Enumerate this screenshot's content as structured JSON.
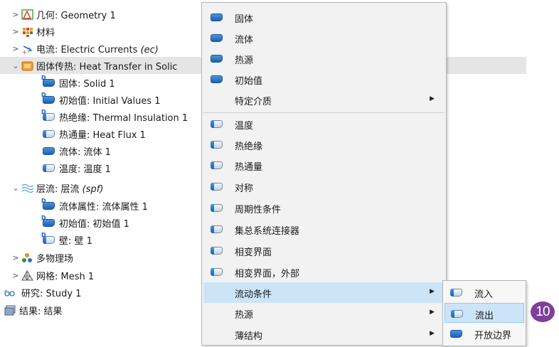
{
  "tree": {
    "items": [
      {
        "label": "几何: Geometry 1",
        "caret": ">",
        "icon": "geometry-icon"
      },
      {
        "label": "材料",
        "caret": ">",
        "icon": "materials-icon"
      },
      {
        "label_main": "电流: Electric Currents ",
        "label_tag": "(ec)",
        "caret": ">",
        "icon": "electric-currents-icon"
      },
      {
        "label": "固体传热: Heat Transfer in Solic",
        "caret": "⌄",
        "icon": "heat-transfer-icon"
      },
      {
        "label": "固体: Solid 1",
        "icon": "feature-icon"
      },
      {
        "label": "初始值: Initial Values 1",
        "icon": "feature-icon"
      },
      {
        "label": "热绝缘: Thermal Insulation 1",
        "icon": "boundary-feature-icon"
      },
      {
        "label": "热通量: Heat Flux 1",
        "icon": "boundary-feature-icon"
      },
      {
        "label": "流体: 流体 1",
        "icon": "feature-icon"
      },
      {
        "label": "温度: 温度 1",
        "icon": "boundary-feature-icon"
      },
      {
        "label_main": "层流: 层流 ",
        "label_tag": "(spf)",
        "caret": "⌄",
        "icon": "laminar-flow-icon"
      },
      {
        "label": "流体属性: 流体属性 1",
        "icon": "feature-icon"
      },
      {
        "label": "初始值: 初始值 1",
        "icon": "feature-icon"
      },
      {
        "label": "壁: 壁 1",
        "icon": "boundary-feature-icon"
      },
      {
        "label": "多物理场",
        "caret": ">",
        "icon": "multiphysics-icon"
      },
      {
        "label": "网格: Mesh 1",
        "caret": ">",
        "icon": "mesh-icon"
      },
      {
        "label": "研究: Study 1",
        "icon": "study-icon"
      },
      {
        "label": "结果: 结果",
        "icon": "results-icon"
      }
    ]
  },
  "menu": {
    "items": [
      {
        "label": "固体",
        "icon": "domain-feature-icon"
      },
      {
        "label": "流体",
        "icon": "domain-feature-icon"
      },
      {
        "label": "热源",
        "icon": "domain-feature-icon"
      },
      {
        "label": "初始值",
        "icon": "domain-feature-icon"
      },
      {
        "label": "特定介质",
        "submenu_arrow": "▶"
      },
      {
        "label": "温度",
        "icon": "boundary-feature-icon"
      },
      {
        "label": "热绝缘",
        "icon": "boundary-feature-icon"
      },
      {
        "label": "热通量",
        "icon": "boundary-feature-icon"
      },
      {
        "label": "对称",
        "icon": "boundary-feature-icon"
      },
      {
        "label": "周期性条件",
        "icon": "boundary-feature-icon"
      },
      {
        "label": "集总系统连接器",
        "icon": "boundary-feature-icon"
      },
      {
        "label": "相变界面",
        "icon": "boundary-feature-icon"
      },
      {
        "label": "相变界面，外部",
        "icon": "boundary-feature-icon"
      },
      {
        "label": "流动条件",
        "submenu_arrow": "▶",
        "highlighted": true
      },
      {
        "label": "热源",
        "submenu_arrow": "▶"
      },
      {
        "label": "薄结构",
        "submenu_arrow": "▶"
      }
    ]
  },
  "submenu": {
    "items": [
      {
        "label": "流入",
        "icon": "boundary-feature-icon"
      },
      {
        "label": "流出",
        "icon": "boundary-feature-icon",
        "highlighted": true
      },
      {
        "label": "开放边界",
        "icon": "domain-feature-icon"
      }
    ]
  },
  "step_badge": "10",
  "colors": {
    "menu_bg": "#f2f2f2",
    "highlight": "#cce4f7",
    "selected_row": "#e5e5e5",
    "icon_blue": "#1f5fb0",
    "badge": "#7c3f9a"
  }
}
